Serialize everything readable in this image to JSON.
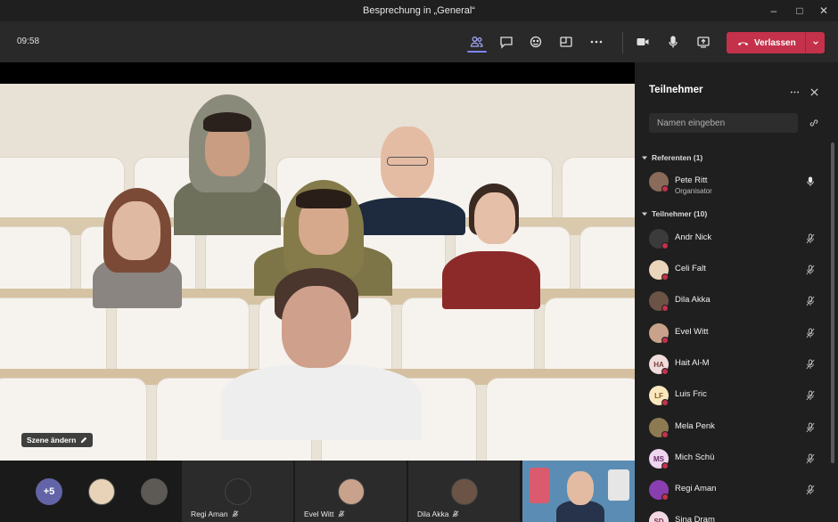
{
  "window": {
    "title": "Besprechung in „General“"
  },
  "toolbar": {
    "clock": "09:58",
    "leave_label": "Verlassen"
  },
  "stage": {
    "change_scene_label": "Szene ändern"
  },
  "strip": {
    "more_count": "+5",
    "tiles": [
      {
        "name": "Regi Aman"
      },
      {
        "name": "Evel Witt"
      },
      {
        "name": "Dila Akka"
      }
    ]
  },
  "panel": {
    "title": "Teilnehmer",
    "search_placeholder": "Namen eingeben",
    "presenters_header": "Referenten (1)",
    "attendees_header": "Teilnehmer (10)",
    "presenters": [
      {
        "name": "Pete Ritt",
        "role": "Organisator"
      }
    ],
    "attendees": [
      {
        "name": "Andr Nick"
      },
      {
        "name": "Celi Falt"
      },
      {
        "name": "Dila Akka"
      },
      {
        "name": "Evel Witt"
      },
      {
        "name": "Hait Al-M",
        "initials": "HA"
      },
      {
        "name": "Luis Fric",
        "initials": "LF"
      },
      {
        "name": "Mela Penk"
      },
      {
        "name": "Mich Schü",
        "initials": "MS"
      },
      {
        "name": "Regi Aman"
      },
      {
        "name": "Sina Dram",
        "initials": "SD"
      }
    ]
  },
  "colors": {
    "accent": "#6264a7",
    "leave": "#c4314b",
    "active_tab": "#7f85f5"
  }
}
